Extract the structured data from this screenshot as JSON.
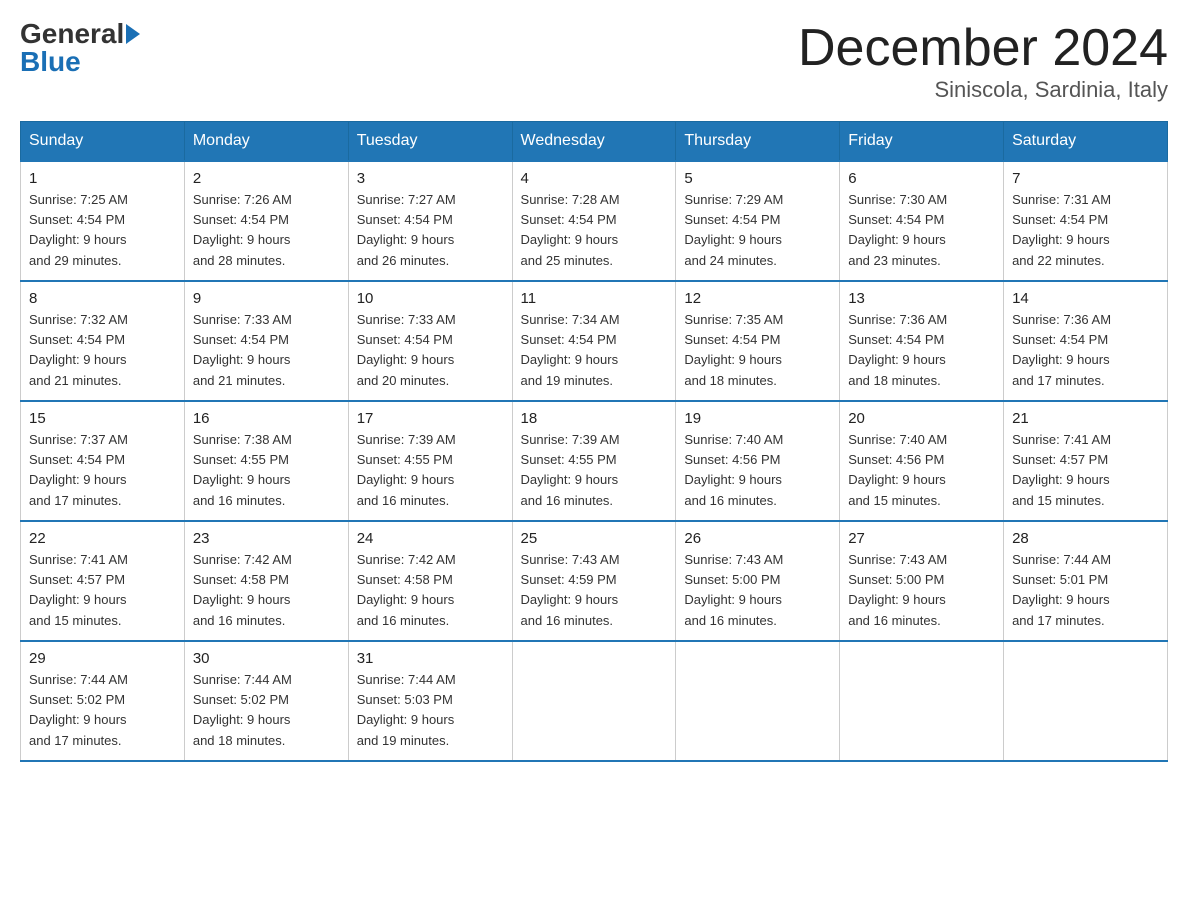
{
  "header": {
    "logo": {
      "general": "General",
      "blue": "Blue"
    },
    "title": "December 2024",
    "location": "Siniscola, Sardinia, Italy"
  },
  "weekdays": [
    "Sunday",
    "Monday",
    "Tuesday",
    "Wednesday",
    "Thursday",
    "Friday",
    "Saturday"
  ],
  "weeks": [
    [
      {
        "day": "1",
        "sunrise": "7:25 AM",
        "sunset": "4:54 PM",
        "daylight": "9 hours and 29 minutes."
      },
      {
        "day": "2",
        "sunrise": "7:26 AM",
        "sunset": "4:54 PM",
        "daylight": "9 hours and 28 minutes."
      },
      {
        "day": "3",
        "sunrise": "7:27 AM",
        "sunset": "4:54 PM",
        "daylight": "9 hours and 26 minutes."
      },
      {
        "day": "4",
        "sunrise": "7:28 AM",
        "sunset": "4:54 PM",
        "daylight": "9 hours and 25 minutes."
      },
      {
        "day": "5",
        "sunrise": "7:29 AM",
        "sunset": "4:54 PM",
        "daylight": "9 hours and 24 minutes."
      },
      {
        "day": "6",
        "sunrise": "7:30 AM",
        "sunset": "4:54 PM",
        "daylight": "9 hours and 23 minutes."
      },
      {
        "day": "7",
        "sunrise": "7:31 AM",
        "sunset": "4:54 PM",
        "daylight": "9 hours and 22 minutes."
      }
    ],
    [
      {
        "day": "8",
        "sunrise": "7:32 AM",
        "sunset": "4:54 PM",
        "daylight": "9 hours and 21 minutes."
      },
      {
        "day": "9",
        "sunrise": "7:33 AM",
        "sunset": "4:54 PM",
        "daylight": "9 hours and 21 minutes."
      },
      {
        "day": "10",
        "sunrise": "7:33 AM",
        "sunset": "4:54 PM",
        "daylight": "9 hours and 20 minutes."
      },
      {
        "day": "11",
        "sunrise": "7:34 AM",
        "sunset": "4:54 PM",
        "daylight": "9 hours and 19 minutes."
      },
      {
        "day": "12",
        "sunrise": "7:35 AM",
        "sunset": "4:54 PM",
        "daylight": "9 hours and 18 minutes."
      },
      {
        "day": "13",
        "sunrise": "7:36 AM",
        "sunset": "4:54 PM",
        "daylight": "9 hours and 18 minutes."
      },
      {
        "day": "14",
        "sunrise": "7:36 AM",
        "sunset": "4:54 PM",
        "daylight": "9 hours and 17 minutes."
      }
    ],
    [
      {
        "day": "15",
        "sunrise": "7:37 AM",
        "sunset": "4:54 PM",
        "daylight": "9 hours and 17 minutes."
      },
      {
        "day": "16",
        "sunrise": "7:38 AM",
        "sunset": "4:55 PM",
        "daylight": "9 hours and 16 minutes."
      },
      {
        "day": "17",
        "sunrise": "7:39 AM",
        "sunset": "4:55 PM",
        "daylight": "9 hours and 16 minutes."
      },
      {
        "day": "18",
        "sunrise": "7:39 AM",
        "sunset": "4:55 PM",
        "daylight": "9 hours and 16 minutes."
      },
      {
        "day": "19",
        "sunrise": "7:40 AM",
        "sunset": "4:56 PM",
        "daylight": "9 hours and 16 minutes."
      },
      {
        "day": "20",
        "sunrise": "7:40 AM",
        "sunset": "4:56 PM",
        "daylight": "9 hours and 15 minutes."
      },
      {
        "day": "21",
        "sunrise": "7:41 AM",
        "sunset": "4:57 PM",
        "daylight": "9 hours and 15 minutes."
      }
    ],
    [
      {
        "day": "22",
        "sunrise": "7:41 AM",
        "sunset": "4:57 PM",
        "daylight": "9 hours and 15 minutes."
      },
      {
        "day": "23",
        "sunrise": "7:42 AM",
        "sunset": "4:58 PM",
        "daylight": "9 hours and 16 minutes."
      },
      {
        "day": "24",
        "sunrise": "7:42 AM",
        "sunset": "4:58 PM",
        "daylight": "9 hours and 16 minutes."
      },
      {
        "day": "25",
        "sunrise": "7:43 AM",
        "sunset": "4:59 PM",
        "daylight": "9 hours and 16 minutes."
      },
      {
        "day": "26",
        "sunrise": "7:43 AM",
        "sunset": "5:00 PM",
        "daylight": "9 hours and 16 minutes."
      },
      {
        "day": "27",
        "sunrise": "7:43 AM",
        "sunset": "5:00 PM",
        "daylight": "9 hours and 16 minutes."
      },
      {
        "day": "28",
        "sunrise": "7:44 AM",
        "sunset": "5:01 PM",
        "daylight": "9 hours and 17 minutes."
      }
    ],
    [
      {
        "day": "29",
        "sunrise": "7:44 AM",
        "sunset": "5:02 PM",
        "daylight": "9 hours and 17 minutes."
      },
      {
        "day": "30",
        "sunrise": "7:44 AM",
        "sunset": "5:02 PM",
        "daylight": "9 hours and 18 minutes."
      },
      {
        "day": "31",
        "sunrise": "7:44 AM",
        "sunset": "5:03 PM",
        "daylight": "9 hours and 19 minutes."
      },
      null,
      null,
      null,
      null
    ]
  ]
}
